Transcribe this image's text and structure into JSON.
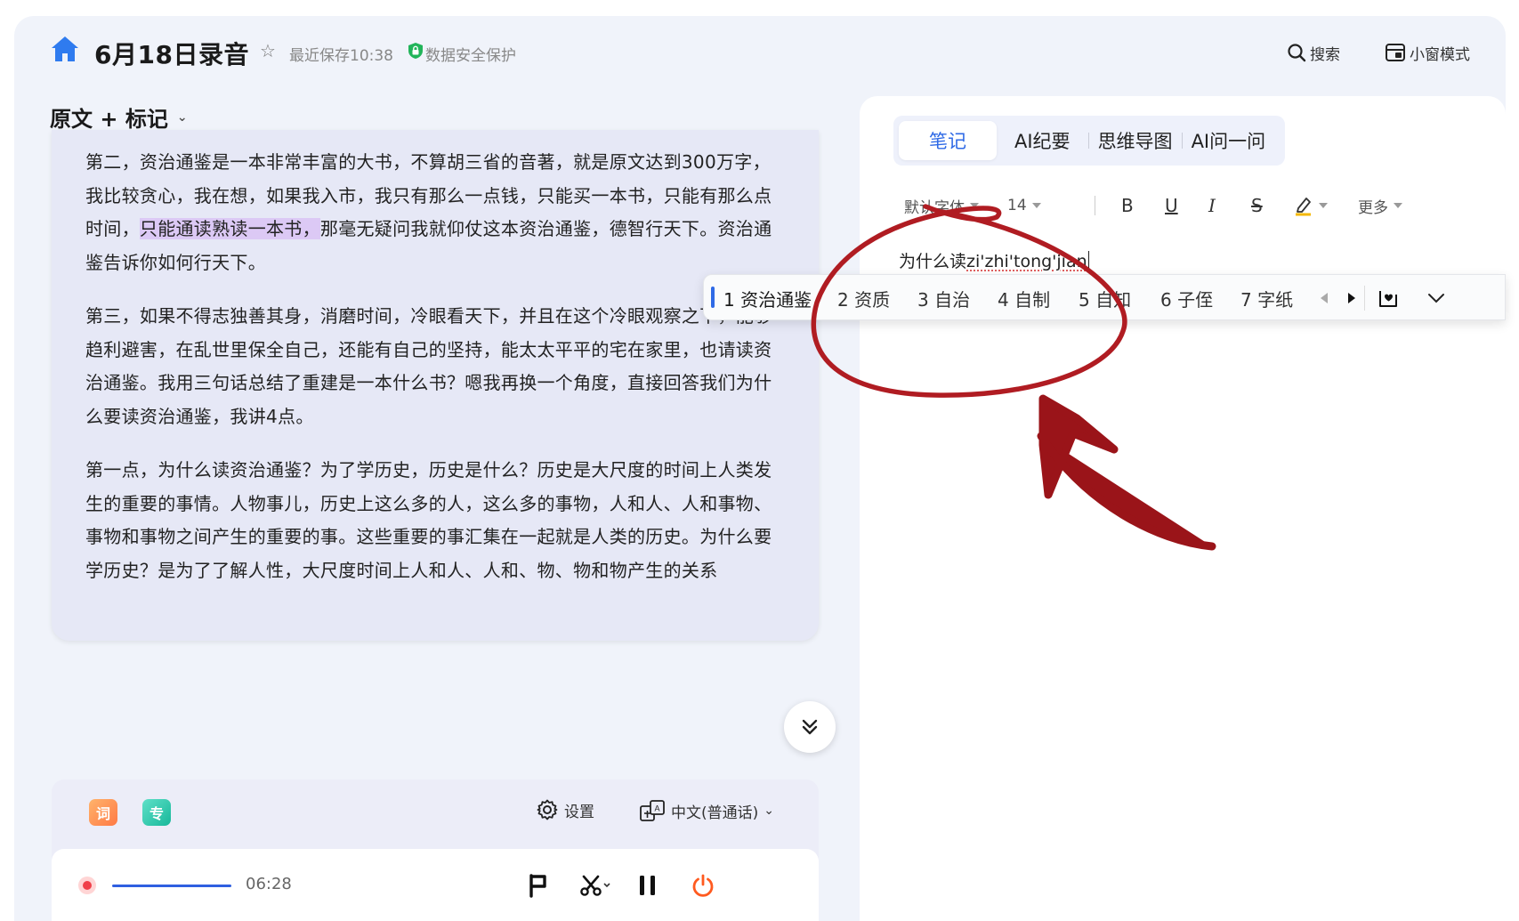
{
  "header": {
    "title": "6月18日录音",
    "save_status": "最近保存10:38",
    "security": "数据安全保护",
    "search_label": "搜索",
    "mini_window_label": "小窗模式"
  },
  "left": {
    "view_title": "原文 + 标记",
    "paragraphs": {
      "p1_a": "第二，资治通鉴是一本非常丰富的大书，不算胡三省的音著，就是原文达到300万字，我比较贪心，我在想，如果我入市，我只有那么一点钱，只能买一本书，只能有那么点时间，",
      "p1_highlight": "只能通读熟读一本书，",
      "p1_b": "那毫无疑问我就仰仗这本资治通鉴，德智行天下。资治通鉴告诉你如何行天下。",
      "p2": "第三，如果不得志独善其身，消磨时间，冷眼看天下，并且在这个冷眼观察之下，能够趋利避害，在乱世里保全自己，还能有自己的坚持，能太太平平的宅在家里，也请读资治通鉴。我用三句话总结了重建是一本什么书？嗯我再换一个角度，直接回答我们为什么要读资治通鉴，我讲4点。",
      "p3": "第一点，为什么读资治通鉴？为了学历史，历史是什么？历史是大尺度的时间上人类发生的重要的事情。人物事儿，历史上这么多的人，这么多的事物，人和人、人和事物、事物和事物之间产生的重要的事。这些重要的事汇集在一起就是人类的历史。为什么要学历史？是为了了解人性，大尺度时间上人和人、人和、物、物和物产生的关系"
    }
  },
  "toolbar": {
    "tag_ci": "词",
    "tag_zhuan": "专",
    "settings_label": "设置",
    "language_label": "中文(普通话)"
  },
  "player": {
    "time": "06:28",
    "progress": 0.2
  },
  "right": {
    "tabs": [
      "笔记",
      "AI纪要",
      "思维导图",
      "AI问一问"
    ],
    "font_family": "默认字体",
    "font_size": "14",
    "bold": "B",
    "underline": "U",
    "italic": "I",
    "strike": "S",
    "more_label": "更多",
    "editor_prefix": "为什么读",
    "editor_pinyin": "zi'zhi'tong'jian"
  },
  "ime": {
    "candidates": [
      "1 资治通鉴",
      "2 资质",
      "3 自治",
      "4 自制",
      "5 自知",
      "6 子侄",
      "7 字纸"
    ]
  },
  "colors": {
    "accent": "#2f6ae6",
    "highlight": "#dcc9f5",
    "annotation": "#b01c22",
    "record": "#f0404a",
    "stop": "#ff5a1f"
  }
}
